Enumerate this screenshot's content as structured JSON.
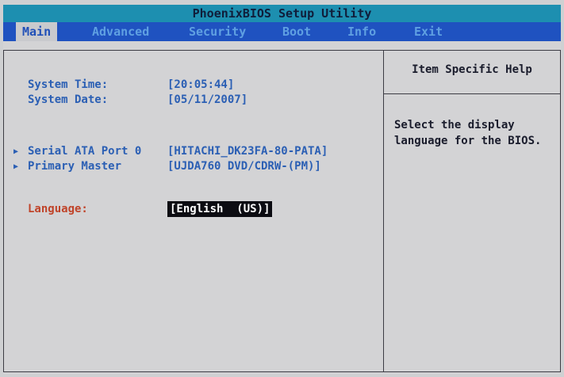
{
  "title": "PhoenixBIOS Setup Utility",
  "menu": [
    "Main",
    "Advanced",
    "Security",
    "Boot",
    "Info",
    "Exit"
  ],
  "active_tab": "Main",
  "fields": {
    "system_time": {
      "label": "System Time:",
      "value": "[20:05:44]"
    },
    "system_date": {
      "label": "System Date:",
      "value": "[05/11/2007]"
    },
    "sata_port0": {
      "label": "Serial ATA Port 0",
      "value": "[HITACHI_DK23FA-80-PATA]"
    },
    "primary_master": {
      "label": "Primary Master",
      "value": "[UJDA760 DVD/CDRW-(PM)]"
    },
    "language": {
      "label": "Language:",
      "value": "[English  (US)]"
    }
  },
  "help": {
    "title": "Item Specific Help",
    "text": "Select the display\nlanguage for the BIOS."
  },
  "colors": {
    "title_bar": "#1d8fb0",
    "menu_bar": "#1f52c0",
    "field_text": "#2b5fb4",
    "selected_label": "#c0442a",
    "highlight": "#0c0c12"
  },
  "icons": {
    "submenu": "triangle-right-icon"
  }
}
